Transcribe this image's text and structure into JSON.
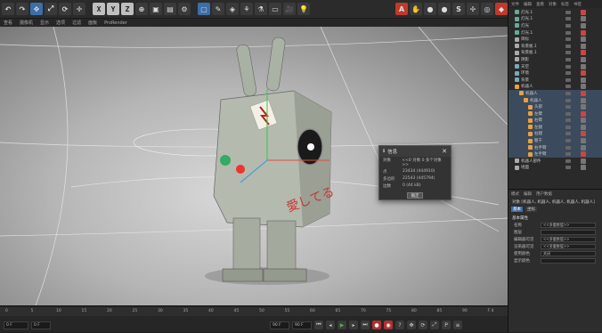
{
  "toolbar": {
    "axis_x": "X",
    "axis_y": "Y",
    "axis_z": "Z"
  },
  "menubar": [
    "查看",
    "摄像机",
    "显示",
    "选项",
    "过滤",
    "面板",
    "ProRender"
  ],
  "dialog": {
    "title": "信息",
    "close": "✕",
    "rows": [
      {
        "k": "对象",
        "v": "<<0 对象 0 多个对象>>"
      },
      {
        "k": "点",
        "v": "23434 (444910)"
      },
      {
        "k": "多边形",
        "v": "22543 (445794)"
      },
      {
        "k": "边数",
        "v": "0 (44 kB)"
      }
    ],
    "ok": "确定"
  },
  "timeline": {
    "ruler_ticks": [
      "0",
      "5",
      "10",
      "15",
      "20",
      "25",
      "30",
      "35",
      "40",
      "45",
      "50",
      "55",
      "60",
      "65",
      "70",
      "75",
      "80",
      "85",
      "90",
      "F 4"
    ],
    "start_field": "0 F",
    "current_field": "0 F",
    "end_field": "90 F",
    "max_field": "90 F"
  },
  "right_panel": {
    "menu": [
      "文件",
      "编辑",
      "查看",
      "对象",
      "标签",
      "书签"
    ],
    "tree": [
      {
        "label": "灯光.1",
        "indent": 1,
        "color": "#6a9"
      },
      {
        "label": "灯光.1",
        "indent": 1,
        "color": "#6a9"
      },
      {
        "label": "灯光",
        "indent": 1,
        "color": "#6a9"
      },
      {
        "label": "灯光.1",
        "indent": 1,
        "color": "#6a9"
      },
      {
        "label": "目标",
        "indent": 1,
        "color": "#aaa"
      },
      {
        "label": "背景板.1",
        "indent": 1,
        "color": "#aaa"
      },
      {
        "label": "背景板.1",
        "indent": 1,
        "color": "#aaa"
      },
      {
        "label": "阴影",
        "indent": 1,
        "color": "#aaa"
      },
      {
        "label": "天空",
        "indent": 1,
        "color": "#7ab"
      },
      {
        "label": "环境",
        "indent": 1,
        "color": "#7ab"
      },
      {
        "label": "背景",
        "indent": 1,
        "color": "#7ab"
      },
      {
        "label": "机器人",
        "indent": 1,
        "color": "#e8a040"
      },
      {
        "label": "机器人",
        "indent": 2,
        "color": "#e8a040"
      },
      {
        "label": "机器人",
        "indent": 3,
        "color": "#e8a040"
      },
      {
        "label": "头部",
        "indent": 4,
        "color": "#e8a040"
      },
      {
        "label": "左臂",
        "indent": 4,
        "color": "#e8a040"
      },
      {
        "label": "右臂",
        "indent": 4,
        "color": "#e8a040"
      },
      {
        "label": "左腿",
        "indent": 4,
        "color": "#e8a040"
      },
      {
        "label": "右腿",
        "indent": 4,
        "color": "#e8a040"
      },
      {
        "label": "躯干",
        "indent": 4,
        "color": "#e8a040"
      },
      {
        "label": "右手臂",
        "indent": 4,
        "color": "#e8a040"
      },
      {
        "label": "左手臂",
        "indent": 4,
        "color": "#e8a040"
      },
      {
        "label": "机器人部件",
        "indent": 1,
        "color": "#aaa"
      },
      {
        "label": "地面",
        "indent": 1,
        "color": "#aaa"
      }
    ],
    "attr_tabs": [
      "模式",
      "编辑",
      "用户数据"
    ],
    "attr_title": "对象 [机器人, 机器人, 机器人, 机器人, 机器人]",
    "attr_subtabs": [
      "基本",
      "坐标"
    ],
    "attr_section": "基本属性",
    "attr_rows": [
      {
        "lbl": "名称",
        "val": "<<多重数值>>"
      },
      {
        "lbl": "图层",
        "val": ""
      },
      {
        "lbl": "编辑器可见",
        "val": "<<多重数值>>"
      },
      {
        "lbl": "渲染器可见",
        "val": "<<多重数值>>"
      },
      {
        "lbl": "使用颜色",
        "val": "关闭"
      },
      {
        "lbl": "显示颜色",
        "val": ""
      }
    ]
  }
}
